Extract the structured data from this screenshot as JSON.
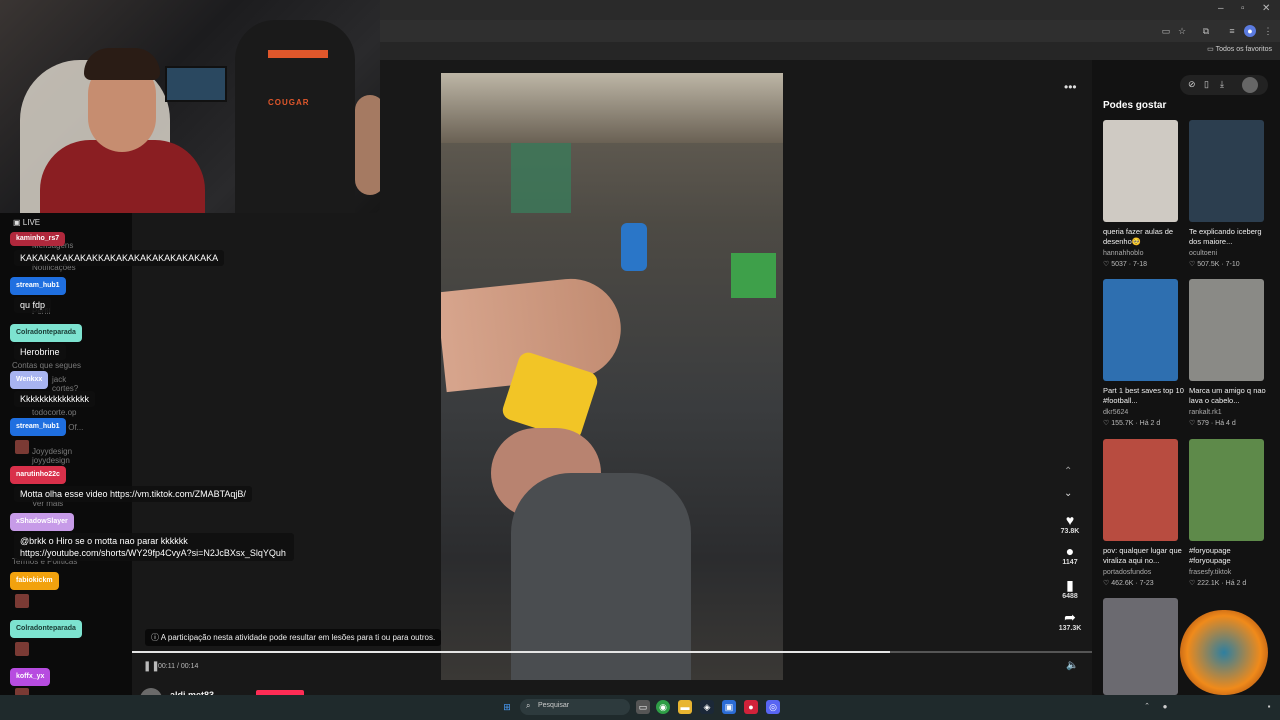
{
  "browser": {
    "bookmarks_label": "Todos os favoritos",
    "icons": [
      "cast-icon",
      "star-icon",
      "extensions-icon",
      "tab-search-icon",
      "profile-icon",
      "menu-icon"
    ]
  },
  "webcam": {
    "brand_text": "COUGAR"
  },
  "stream": {
    "live_label": "LIVE",
    "chat": [
      {
        "user": "kaminho_rs7",
        "color": "#b0283c",
        "text": "KAKAKAKAKAKAKKAKAKAKAKAKAKAKAKAKA"
      },
      {
        "user": "stream_hub1",
        "color": "#1f6fe0",
        "text": "qu fdp"
      },
      {
        "user": "Colradonteparada",
        "color": "#7de3d0",
        "text": "Herobrine"
      },
      {
        "user": "Wenkxx",
        "color": "#a8b4f0",
        "text": "Kkkkkkkkkkkkkkk"
      },
      {
        "user": "stream_hub1",
        "color": "#1f6fe0",
        "text": ""
      },
      {
        "user": "narutinho22c",
        "color": "#d9304a",
        "text": "Motta olha esse video https://vm.tiktok.com/ZMABTAqjB/"
      },
      {
        "user": "xShadowSlayer",
        "color": "#c79be8",
        "text": "@brkk o Hiro se o motta nao parar kkkkkk https://youtube.com/shorts/WY29fp4CvyA?si=N2JcBXsx_SlqYQuh"
      },
      {
        "user": "fabiokickm",
        "color": "#f2a20e",
        "text": ""
      },
      {
        "user": "Colradonteparada",
        "color": "#7de3d0",
        "text": ""
      },
      {
        "user": "koffx_yx",
        "color": "#b74ce0",
        "text": ""
      }
    ]
  },
  "sidebar_ghost": {
    "messages": "Mensagens",
    "notifications": "Notificações",
    "profile": "Perfil",
    "following": "Contas que segues",
    "f1": "jack",
    "f2": "cortes?",
    "f3": "todocorte.op",
    "f4": "s Of...",
    "f5": "Joyydesign",
    "f6": "joyydesign",
    "see_more": "Ver mais",
    "terms": "Termos e Políticas"
  },
  "player": {
    "warning": "A participação nesta atividade pode resultar em lesões para ti ou para outros.",
    "time": "00:11 / 00:14",
    "more_icon": "more-icon",
    "author": "aldi met83",
    "likes": "73.8K",
    "comments": "1147",
    "saves": "6488",
    "shares": "137.3K",
    "progress": 0.79
  },
  "suggestions": {
    "title": "Podes gostar",
    "items": [
      {
        "caption": "queria fazer aulas de desenho🥺",
        "user": "hannahhoblo",
        "stats": "5037 · 7-18",
        "color": "#cfcac3"
      },
      {
        "caption": "Te explicando iceberg dos maiore...",
        "user": "ocultoeni",
        "stats": "507.5K · 7-10",
        "color": "#2c3e4f"
      },
      {
        "caption": "Part 1 best saves top 10 #football...",
        "user": "dkr5624",
        "stats": "155.7K · Há 2 d",
        "color": "#2e6fb0"
      },
      {
        "caption": "Marca um amigo q nao lava o cabelo...",
        "user": "rankalt.rk1",
        "stats": "579 · Há 4 d",
        "color": "#8a8a86"
      },
      {
        "caption": "pov: qualquer lugar que viraliza aqui no...",
        "user": "portadosfundos",
        "stats": "462.6K · 7-23",
        "color": "#b84c40"
      },
      {
        "caption": "#foryoupage #foryoupage",
        "user": "frasesfy.tiktok",
        "stats": "222.1K · Há 2 d",
        "color": "#5e8a4a"
      },
      {
        "caption": "",
        "user": "",
        "stats": "",
        "color": "#6b6a70"
      }
    ]
  },
  "taskbar": {
    "search": "Pesquisar"
  }
}
